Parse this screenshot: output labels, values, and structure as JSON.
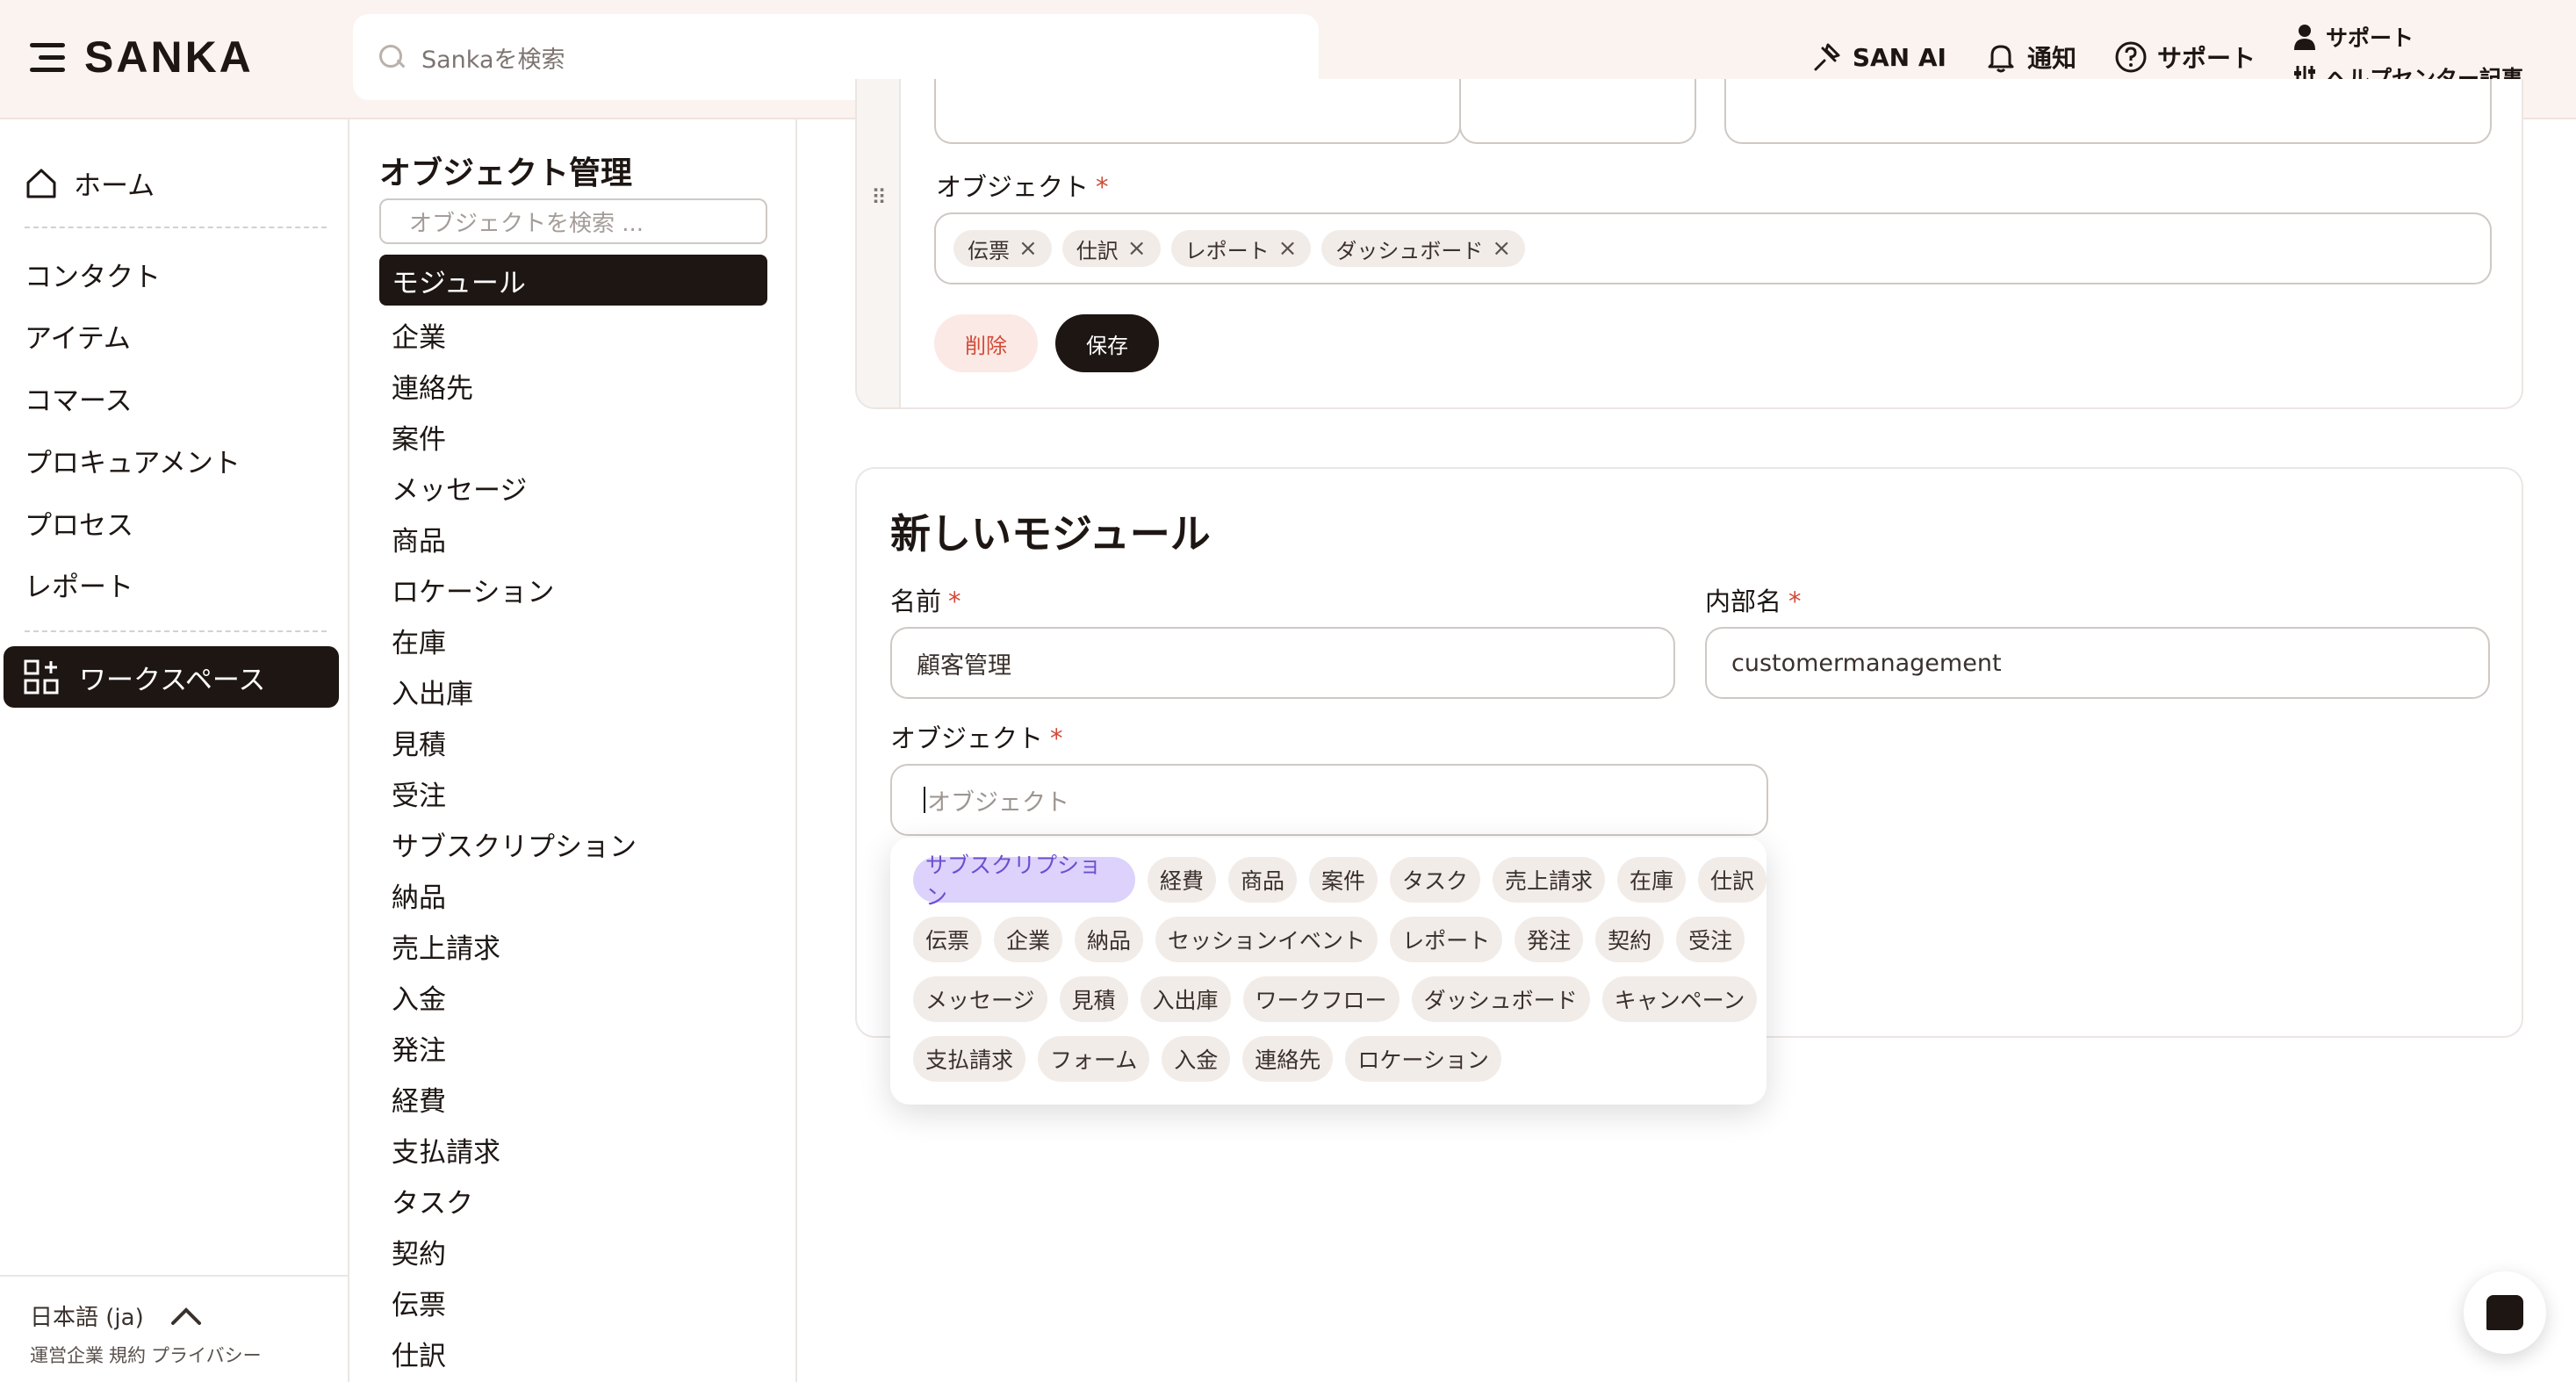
{
  "header": {
    "brand": "SANKA",
    "search_placeholder": "Sankaを検索",
    "nav": {
      "ai": "SAN AI",
      "notifications": "通知",
      "support": "サポート",
      "support_block_top": "サポート",
      "help_center": "ヘルプセンター記事"
    }
  },
  "sidebar": {
    "home": "ホーム",
    "items": [
      "コンタクト",
      "アイテム",
      "コマース",
      "プロキュアメント",
      "プロセス",
      "レポート"
    ],
    "workspace": "ワークスペース",
    "language": "日本語 (ja)",
    "footer_links": [
      "運営企業",
      "規約",
      "プライバシー"
    ]
  },
  "object_panel": {
    "title": "オブジェクト管理",
    "search_placeholder": "オブジェクトを検索 ...",
    "active": "モジュール",
    "items": [
      "企業",
      "連絡先",
      "案件",
      "メッセージ",
      "商品",
      "ロケーション",
      "在庫",
      "入出庫",
      "見積",
      "受注",
      "サブスクリプション",
      "納品",
      "売上請求",
      "入金",
      "発注",
      "経費",
      "支払請求",
      "タスク",
      "契約",
      "伝票",
      "仕訳"
    ]
  },
  "existing_module": {
    "objects_label": "オブジェクト",
    "tags": [
      "伝票",
      "仕訳",
      "レポート",
      "ダッシュボード"
    ],
    "delete_label": "削除",
    "save_label": "保存"
  },
  "new_module": {
    "title": "新しいモジュール",
    "name_label": "名前",
    "name_value": "顧客管理",
    "internal_label": "内部名",
    "internal_value": "customermanagement",
    "objects_label": "オブジェクト",
    "objects_placeholder": "オブジェクト",
    "required_mark": "*"
  },
  "dropdown": {
    "rows": [
      [
        "サブスクリプション",
        "経費",
        "商品",
        "案件",
        "タスク",
        "売上請求",
        "在庫",
        "仕訳"
      ],
      [
        "伝票",
        "企業",
        "納品",
        "セッションイベント",
        "レポート",
        "発注",
        "契約",
        "受注"
      ],
      [
        "メッセージ",
        "見積",
        "入出庫",
        "ワークフロー",
        "ダッシュボード",
        "キャンペーン"
      ],
      [
        "支払請求",
        "フォーム",
        "入金",
        "連絡先",
        "ロケーション"
      ]
    ],
    "highlighted": "サブスクリプション"
  },
  "colors": {
    "accent_dark": "#1d1613",
    "header_bg": "#fbf3ef",
    "required": "#d14b38",
    "chip_selected_bg": "#ddd2fb",
    "chip_selected_text": "#6b4fd0"
  }
}
